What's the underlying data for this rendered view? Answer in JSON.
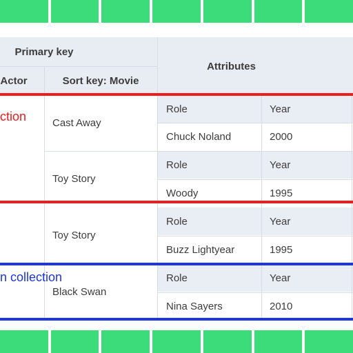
{
  "table": {
    "header": {
      "primary_key": "Primary key",
      "partition_key": "Actor",
      "sort_key": "Sort key: Movie",
      "attributes": "Attributes"
    },
    "item_collections": [
      {
        "label": "ction",
        "color": "#ee1c1c"
      },
      {
        "label": "n collection",
        "color": "#1d34e0"
      }
    ],
    "rows": [
      {
        "movie": "Cast Away",
        "attr_labels": [
          "Role",
          "Year"
        ],
        "attr_values": [
          "Chuck Noland",
          "2000"
        ]
      },
      {
        "movie": "Toy Story",
        "attr_labels": [
          "Role",
          "Year"
        ],
        "attr_values": [
          "Woody",
          "1995"
        ]
      },
      {
        "movie": "Toy Story",
        "attr_labels": [
          "Role",
          "Year"
        ],
        "attr_values": [
          "Buzz Lightyear",
          "1995"
        ]
      },
      {
        "movie": "Black Swan",
        "attr_labels": [
          "Role",
          "Year"
        ],
        "attr_values": [
          "Nina Sayers",
          "2010"
        ]
      }
    ]
  }
}
